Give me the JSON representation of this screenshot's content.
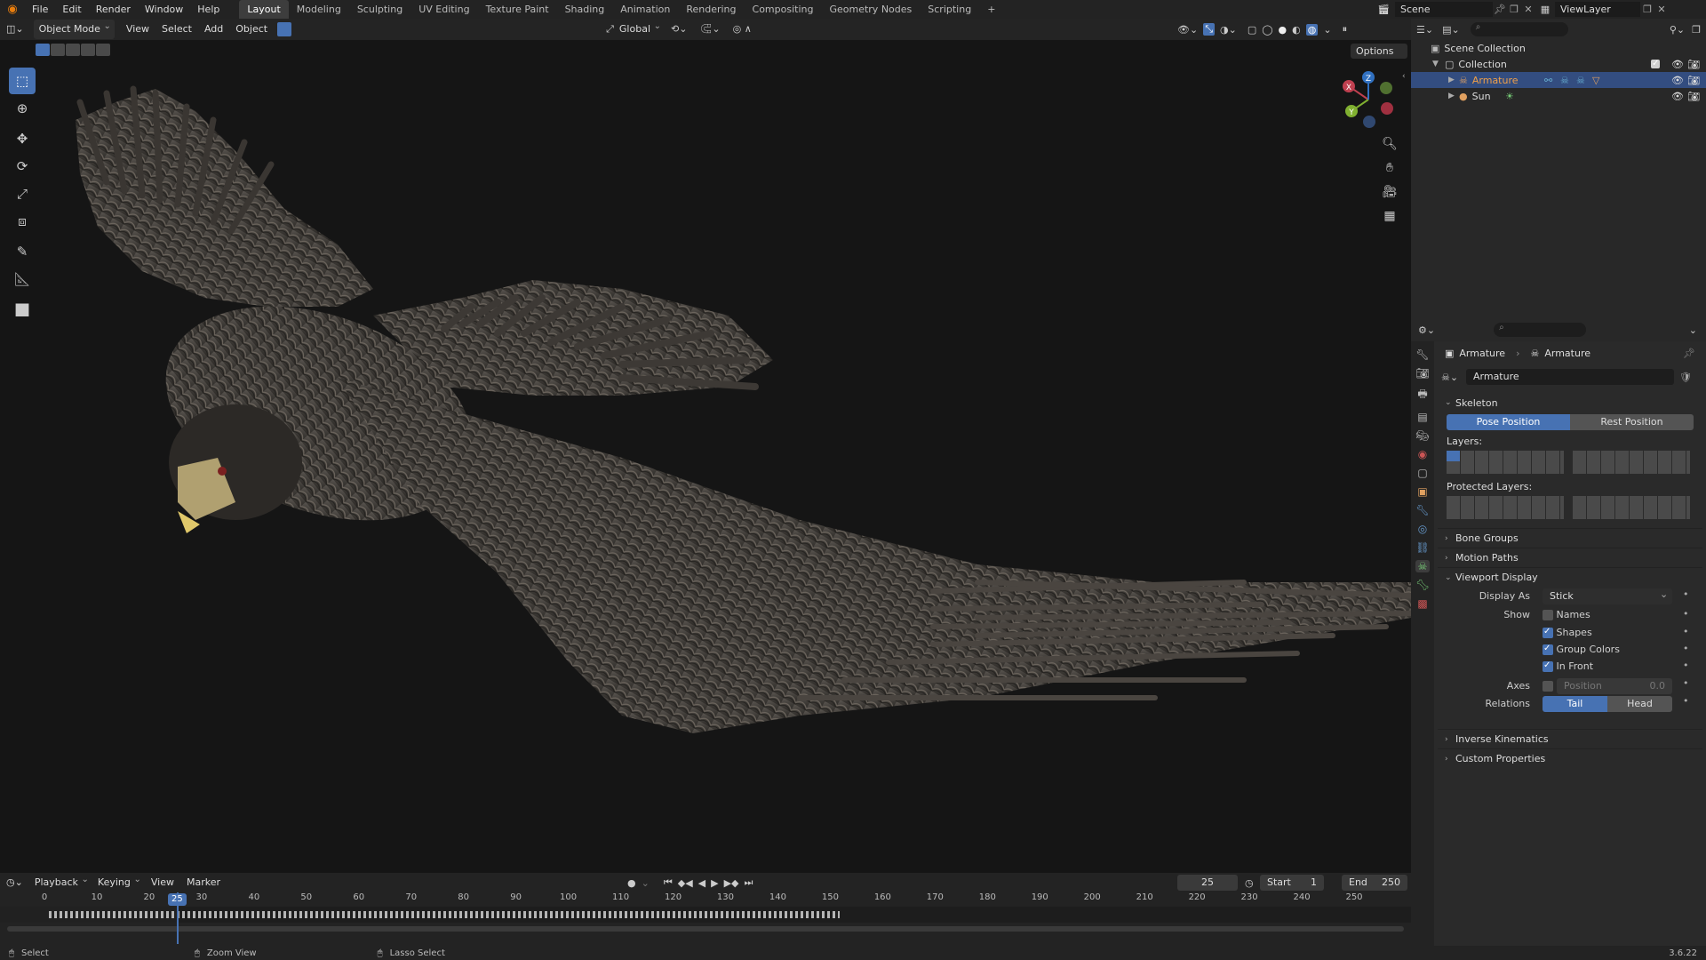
{
  "topbar": {
    "menus": [
      "File",
      "Edit",
      "Render",
      "Window",
      "Help"
    ],
    "workspaces": [
      "Layout",
      "Modeling",
      "Sculpting",
      "UV Editing",
      "Texture Paint",
      "Shading",
      "Animation",
      "Rendering",
      "Compositing",
      "Geometry Nodes",
      "Scripting"
    ],
    "active_workspace": "Layout",
    "add_tab": "+",
    "scene": "Scene",
    "view_layer": "ViewLayer"
  },
  "viewport_header": {
    "mode": "Object Mode",
    "menus": [
      "View",
      "Select",
      "Add",
      "Object"
    ],
    "transform": "Global",
    "options": "Options"
  },
  "outliner": {
    "scene_collection": "Scene Collection",
    "collection": "Collection",
    "items": [
      {
        "name": "Armature",
        "selected": true
      },
      {
        "name": "Sun",
        "selected": false
      }
    ]
  },
  "properties": {
    "breadcrumb": [
      "Armature",
      "Armature"
    ],
    "data_name": "Armature",
    "skeleton": {
      "title": "Skeleton",
      "pose_position": "Pose Position",
      "rest_position": "Rest Position",
      "layers_label": "Layers:",
      "protected_label": "Protected Layers:"
    },
    "collapsed_panels": [
      "Bone Groups",
      "Motion Paths"
    ],
    "viewport_display": {
      "title": "Viewport Display",
      "display_as_label": "Display As",
      "display_as": "Stick",
      "show_label": "Show",
      "names": "Names",
      "shapes": "Shapes",
      "group_colors": "Group Colors",
      "in_front": "In Front",
      "axes_label": "Axes",
      "position_label": "Position",
      "position_value": "0.0",
      "relations_label": "Relations",
      "tail": "Tail",
      "head": "Head"
    },
    "bottom_panels": [
      "Inverse Kinematics",
      "Custom Properties"
    ]
  },
  "timeline": {
    "menus": [
      "Playback",
      "Keying",
      "View",
      "Marker"
    ],
    "current_frame": "25",
    "start_label": "Start",
    "start": "1",
    "end_label": "End",
    "end": "250",
    "ticks": [
      "0",
      "10",
      "20",
      "30",
      "40",
      "50",
      "60",
      "70",
      "80",
      "90",
      "100",
      "110",
      "120",
      "130",
      "140",
      "150",
      "160",
      "170",
      "180",
      "190",
      "200",
      "210",
      "220",
      "230",
      "240",
      "250"
    ],
    "frame_marker": "25"
  },
  "statusbar": {
    "items": [
      "Select",
      "Zoom View",
      "Lasso Select"
    ],
    "version": "3.6.22"
  },
  "colors": {
    "accent": "#4772b3",
    "selected_row": "#334d80",
    "viewport_bg": "#151515"
  }
}
